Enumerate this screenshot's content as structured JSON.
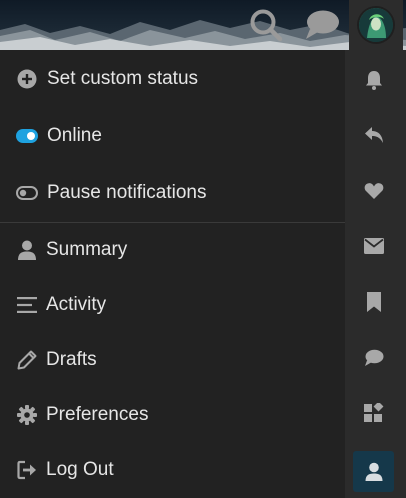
{
  "header": {
    "search_icon": "search-icon",
    "chat_icon": "chat-icon",
    "avatar_icon": "user-avatar"
  },
  "menu": {
    "items": [
      {
        "label": "Set custom status",
        "icon": "plus-circle-icon"
      },
      {
        "label": "Online",
        "icon": "toggle-on-icon"
      },
      {
        "label": "Pause notifications",
        "icon": "toggle-off-icon"
      },
      {
        "label": "Summary",
        "icon": "user-icon"
      },
      {
        "label": "Activity",
        "icon": "bars-icon"
      },
      {
        "label": "Drafts",
        "icon": "pencil-icon"
      },
      {
        "label": "Preferences",
        "icon": "gear-icon"
      },
      {
        "label": "Log Out",
        "icon": "sign-out-icon"
      }
    ]
  },
  "rail": {
    "items": [
      "bell-icon",
      "reply-icon",
      "heart-icon",
      "envelope-icon",
      "bookmark-icon",
      "comment-icon",
      "widgets-icon",
      "user-icon"
    ]
  },
  "colors": {
    "background": "#222222",
    "rail": "#2b2b2b",
    "text": "#e6e6e6",
    "icon": "#a8a8a8",
    "accent": "#1ea2e0",
    "active_bg": "#15384a"
  }
}
